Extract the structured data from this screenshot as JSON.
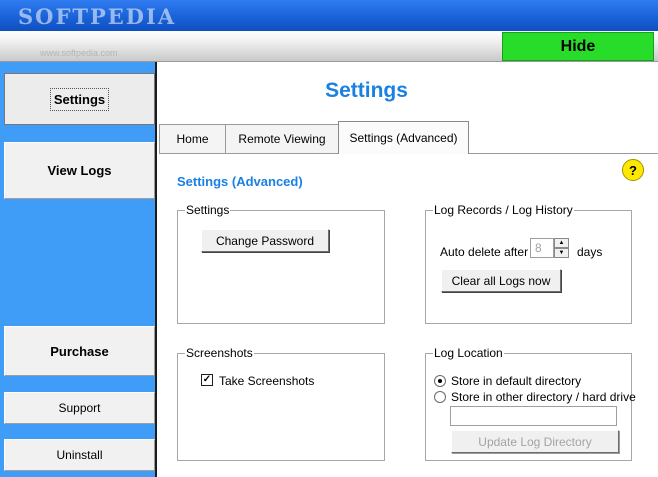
{
  "window": {
    "watermark": "SOFTPEDIA",
    "watermark_sub": "www.softpedia.com"
  },
  "header": {
    "hide_label": "Hide"
  },
  "sidebar": {
    "items": [
      {
        "label": "Settings",
        "active": true
      },
      {
        "label": "View Logs"
      },
      {
        "label": "Purchase"
      },
      {
        "label": "Support"
      },
      {
        "label": "Uninstall"
      }
    ]
  },
  "main": {
    "title": "Settings",
    "tabs": [
      {
        "label": "Home"
      },
      {
        "label": "Remote Viewing"
      },
      {
        "label": "Settings (Advanced)",
        "active": true
      }
    ],
    "help_label": "?",
    "section_title": "Settings (Advanced)",
    "settings_group": {
      "label": "Settings",
      "change_password_label": "Change Password"
    },
    "log_records_group": {
      "label": "Log Records / Log History",
      "auto_delete_label": "Auto delete after",
      "days_value": "8",
      "days_label": "days",
      "clear_logs_label": "Clear all Logs now"
    },
    "screenshots_group": {
      "label": "Screenshots",
      "take_screenshots_label": "Take Screenshots",
      "take_screenshots_checked": true
    },
    "log_location_group": {
      "label": "Log Location",
      "default_dir_label": "Store in default directory",
      "other_dir_label": "Store in other directory / hard drive",
      "directory_value": "",
      "update_dir_label": "Update Log Directory"
    }
  },
  "colors": {
    "accent": "#1a80e4",
    "sidebar": "#3f9cf7",
    "hide_button": "#28dc2a",
    "help_button": "#ffe800"
  }
}
